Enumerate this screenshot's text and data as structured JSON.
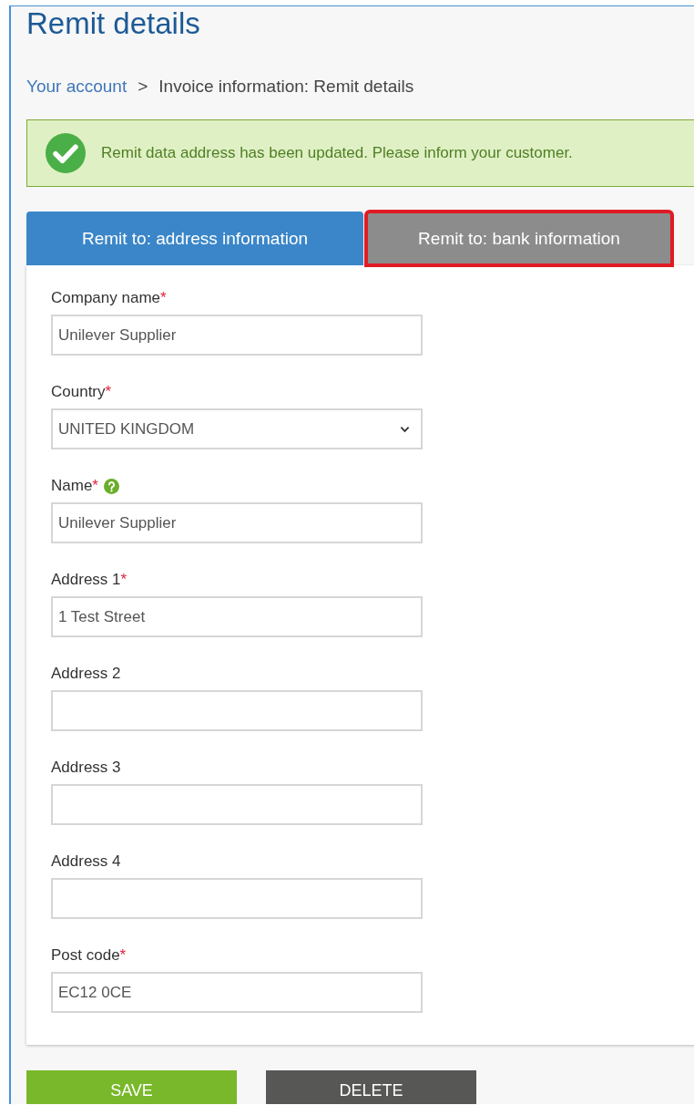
{
  "title": "Remit details",
  "breadcrumb": {
    "link": "Your account",
    "separator": ">",
    "current": "Invoice information:  Remit details"
  },
  "alert": {
    "kind": "success",
    "message": "Remit data address has been updated. Please inform your customer."
  },
  "tabs": [
    {
      "label": "Remit to: address information",
      "selected": true,
      "highlighted": false
    },
    {
      "label": "Remit to: bank information",
      "selected": false,
      "highlighted": true
    }
  ],
  "fields": [
    {
      "label": "Company name",
      "required_mark": "*",
      "help": false,
      "kind": "text",
      "value": "Unilever Supplier"
    },
    {
      "label": "Country",
      "required_mark": "*",
      "help": false,
      "kind": "select",
      "value": "UNITED KINGDOM"
    },
    {
      "label": "Name",
      "required_mark": "*",
      "help": true,
      "kind": "text",
      "value": "Unilever Supplier"
    },
    {
      "label": "Address 1",
      "required_mark": "*",
      "help": false,
      "kind": "text",
      "value": "1 Test Street"
    },
    {
      "label": "Address 2",
      "help": false,
      "kind": "text"
    },
    {
      "label": "Address 3",
      "help": false,
      "kind": "text"
    },
    {
      "label": "Address 4",
      "help": false,
      "kind": "text"
    },
    {
      "label": "Post code",
      "required_mark": "*",
      "help": false,
      "kind": "text",
      "value": "EC12 0CE"
    }
  ],
  "buttons": [
    {
      "label": "SAVE",
      "kind": "primary"
    },
    {
      "label": "DELETE",
      "kind": "danger"
    }
  ]
}
